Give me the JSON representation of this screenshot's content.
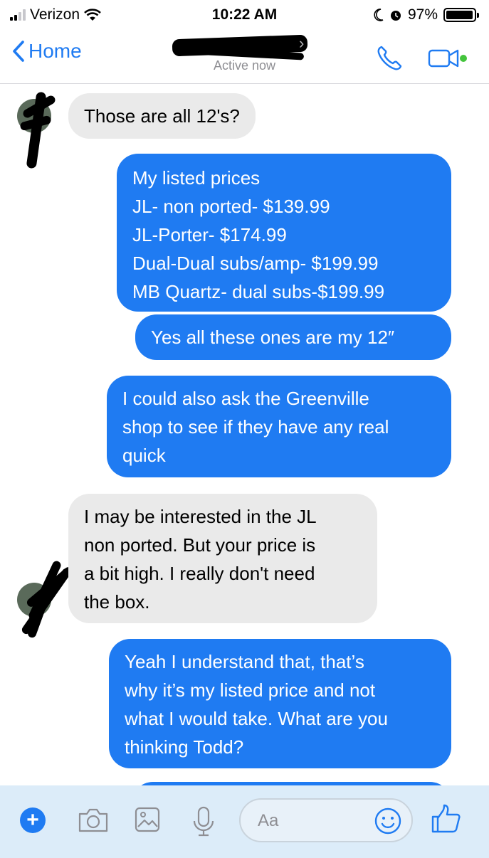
{
  "status_bar": {
    "carrier": "Verizon",
    "time": "10:22 AM",
    "battery": "97%",
    "battery_level": 0.97
  },
  "nav": {
    "back_label": "Home",
    "subtitle": "Active now"
  },
  "messages": [
    {
      "direction": "in",
      "lines": [
        "Those are all 12's?"
      ]
    },
    {
      "direction": "out",
      "lines": [
        "My listed prices",
        "JL- non ported- $139.99",
        "JL-Porter- $174.99",
        "Dual-Dual subs/amp- $199.99",
        "MB Quartz- dual subs-$199.99"
      ]
    },
    {
      "direction": "out",
      "lines": [
        "Yes all these ones are my 12″"
      ]
    },
    {
      "direction": "out",
      "lines": [
        "I could also ask the Greenville",
        "shop to see if they have any real",
        "quick"
      ]
    },
    {
      "direction": "in",
      "lines": [
        "I may be interested in the JL",
        "non ported. But your price is",
        "a bit high. I really don't need",
        "the box."
      ]
    },
    {
      "direction": "out",
      "lines": [
        "Yeah I understand that, that’s",
        "why it’s my listed price and not",
        "what I would take. What are you",
        "thinking Todd?"
      ]
    }
  ],
  "composer": {
    "placeholder": "Aa"
  },
  "colors": {
    "accent": "#1f7bf2",
    "incoming_bubble": "#eaeaea",
    "composer_bg": "#dcecf9",
    "online_dot": "#44c43c"
  },
  "icons": [
    "signal-icon",
    "wifi-icon",
    "moon-icon",
    "alarm-icon",
    "battery-icon",
    "back-chevron-icon",
    "phone-icon",
    "video-camera-icon",
    "plus-icon",
    "camera-icon",
    "gallery-icon",
    "microphone-icon",
    "emoji-icon",
    "thumbs-up-icon"
  ]
}
